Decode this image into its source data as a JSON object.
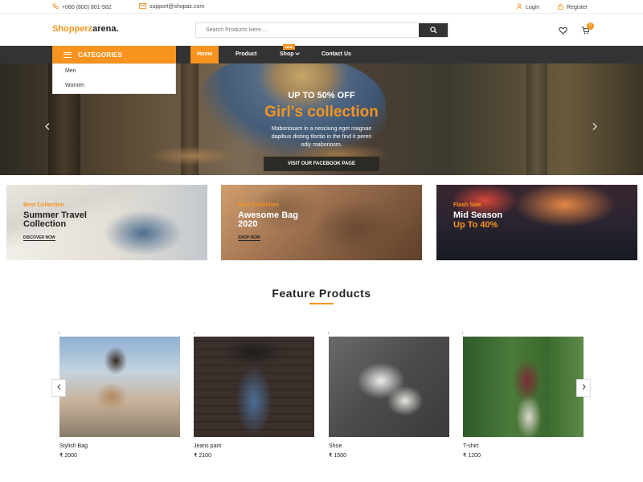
{
  "topbar": {
    "phone": "+060 (800) 801-582",
    "email": "support@shopaz.com",
    "login": "Login",
    "register": "Register"
  },
  "header": {
    "logo_main": "Shopperz",
    "logo_rest": "arena.",
    "search_placeholder": "Search Products Here....",
    "cart_count": "0"
  },
  "nav": {
    "categories_label": "CATEGORIES",
    "links": [
      "Home",
      "Product",
      "Shop",
      "Contact Us"
    ],
    "shop_badge": "NEW"
  },
  "categories_menu": [
    "Men",
    "Women"
  ],
  "hero": {
    "kicker": "UP TO 50% OFF",
    "title": "Girl's collection",
    "body_line1": "Maboriosam in a nesciung eget magnae",
    "body_line2": "dapibus disting tloctio in the find it pereri",
    "body_line3": "odiy maboriosm.",
    "button": "VISIT OUR FACEBOOK PAGE"
  },
  "banners": [
    {
      "kicker": "Best Collection",
      "title_line1": "Summer Travel",
      "title_line2": "Collection",
      "cta": "DISCOVER NOW"
    },
    {
      "kicker": "Best Collection",
      "title_line1": "Awesome Bag",
      "title_line2": "2020",
      "cta": "SHOP NOW"
    },
    {
      "kicker": "Flash Sale",
      "title_line1": "Mid Season",
      "title_line2": "Up To 40%"
    }
  ],
  "feature": {
    "title": "Feature Products",
    "products": [
      {
        "name": "Stylish Bag",
        "price": "₹ 2000"
      },
      {
        "name": "Jeans pant",
        "price": "₹ 2100"
      },
      {
        "name": "Shoe",
        "price": "₹ 1500"
      },
      {
        "name": "T-shirt",
        "price": "₹ 1200"
      }
    ]
  },
  "colors": {
    "accent": "#f7931e",
    "nav_bg": "#333333"
  },
  "icons": [
    "phone-icon",
    "mail-icon",
    "user-icon",
    "lock-icon",
    "search-icon",
    "heart-icon",
    "cart-icon",
    "menu-icon",
    "chevron-down-icon",
    "chevron-left-icon",
    "chevron-right-icon"
  ]
}
